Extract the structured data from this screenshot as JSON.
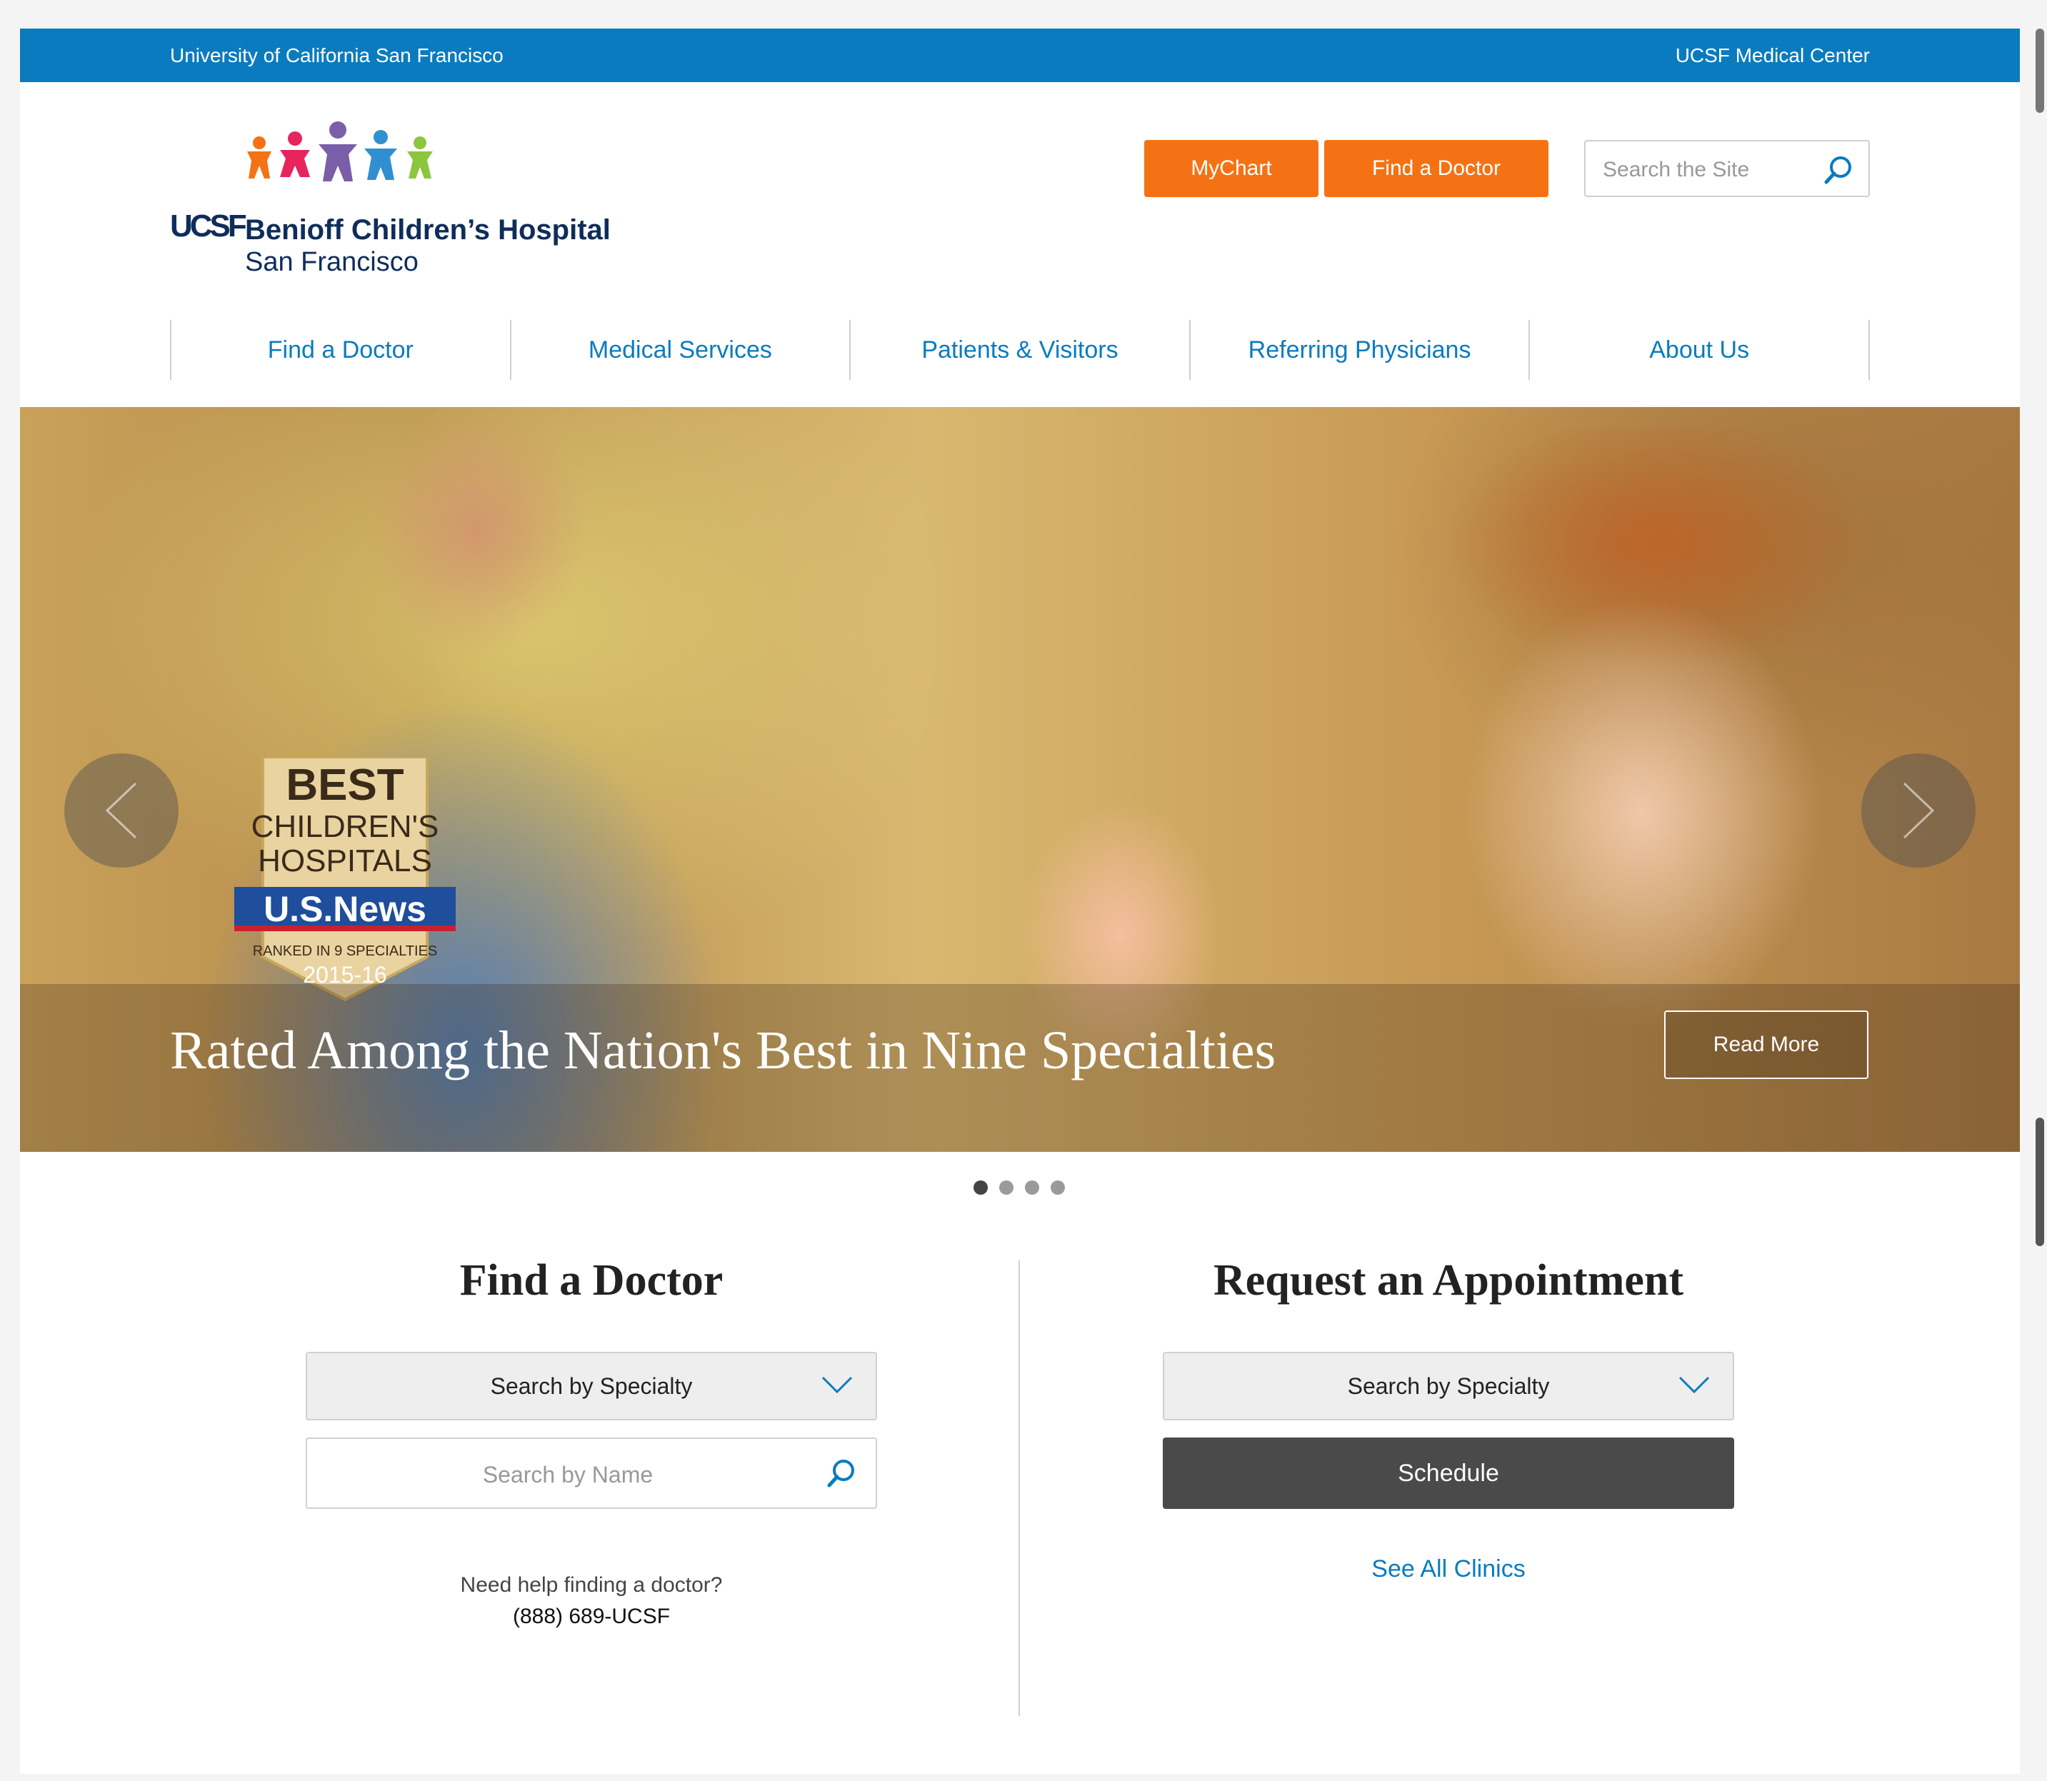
{
  "utility_bar": {
    "left_link": "University of California San Francisco",
    "right_link": "UCSF Medical Center"
  },
  "logo": {
    "mark": "UCSF",
    "name": "Benioff Children’s Hospital",
    "city": "San Francisco",
    "figures_colors": [
      "#f57214",
      "#e8245c",
      "#7a5ea8",
      "#2f8fd0",
      "#8cc63f"
    ]
  },
  "header": {
    "mychart_label": "MyChart",
    "find_doctor_label": "Find a Doctor",
    "search_placeholder": "Search the Site"
  },
  "nav": {
    "items": [
      {
        "label": "Find a Doctor"
      },
      {
        "label": "Medical Services"
      },
      {
        "label": "Patients & Visitors"
      },
      {
        "label": "Referring Physicians"
      },
      {
        "label": "About Us"
      }
    ]
  },
  "hero": {
    "caption": "Rated Among the Nation's Best in Nine Specialties",
    "read_more": "Read More",
    "badge": {
      "line1": "BEST",
      "line2": "CHILDREN'S",
      "line3": "HOSPITALS",
      "brand": "U.S.News",
      "ranked": "RANKED IN 9 SPECIALTIES",
      "year": "2015-16"
    },
    "slides_total": 4,
    "active_slide": 1
  },
  "find_doctor": {
    "title": "Find a Doctor",
    "specialty_select": "Search by Specialty",
    "name_placeholder": "Search by Name",
    "help_text": "Need help finding a doctor?",
    "phone": "(888) 689-UCSF"
  },
  "appointment": {
    "title": "Request an Appointment",
    "specialty_select": "Search by Specialty",
    "schedule_label": "Schedule",
    "see_all_label": "See All Clinics"
  },
  "colors": {
    "brand_blue": "#0a7bbf",
    "accent_orange": "#f57214",
    "navy": "#0f2d5a",
    "dark_button": "#4a4a4a"
  },
  "icons": {
    "search": "search-icon",
    "dropdown": "chevron-down-icon",
    "prev": "chevron-left-icon",
    "next": "chevron-right-icon"
  }
}
